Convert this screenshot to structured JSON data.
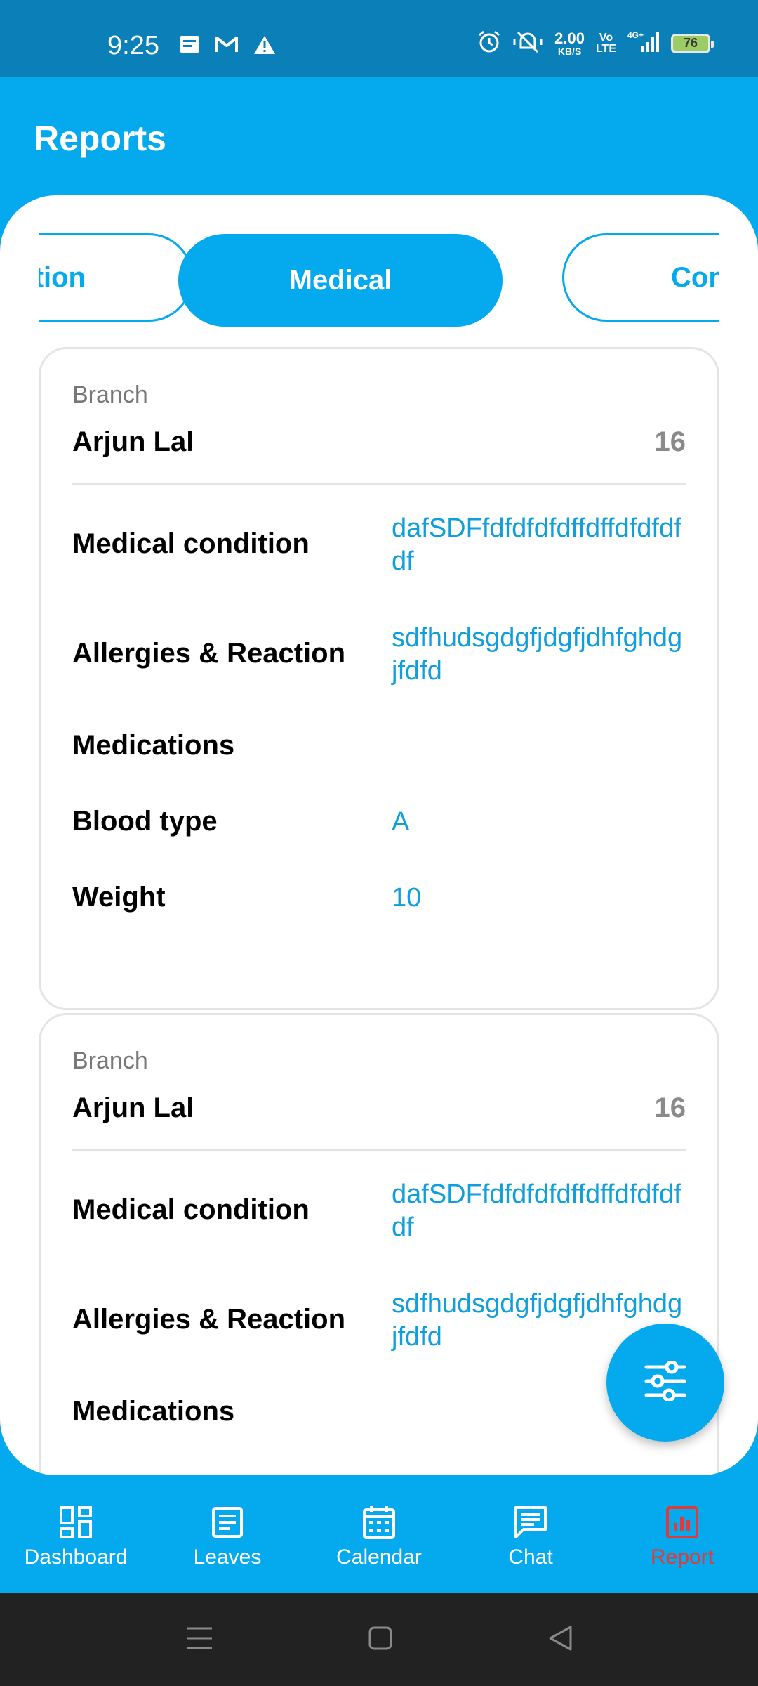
{
  "status_bar": {
    "time": "9:25",
    "net_speed_value": "2.00",
    "net_speed_unit": "KB/S",
    "volte_top": "Vo",
    "volte_bottom": "LTE",
    "network": "4G+",
    "battery": "76",
    "icons": [
      "message-icon",
      "gmail-icon",
      "warning-icon",
      "alarm-icon",
      "silent-icon",
      "signal-icon",
      "battery-icon"
    ]
  },
  "header": {
    "title": "Reports"
  },
  "tabs": [
    {
      "label": "tion",
      "active": false
    },
    {
      "label": "Medical",
      "active": true
    },
    {
      "label": "Con",
      "active": false
    }
  ],
  "cards": [
    {
      "label": "Branch",
      "name": "Arjun Lal",
      "number": "16",
      "rows": [
        {
          "label": "Medical condition",
          "value": "dafSDFfdfdfdfdffdffdfdfdfdf"
        },
        {
          "label": "Allergies & Reaction",
          "value": "sdfhudsgdgfjdgfjdhfghdgjfdfd"
        },
        {
          "label": "Medications",
          "value": ""
        },
        {
          "label": "Blood type",
          "value": "A"
        },
        {
          "label": "Weight",
          "value": "10"
        }
      ]
    },
    {
      "label": "Branch",
      "name": "Arjun Lal",
      "number": "16",
      "rows": [
        {
          "label": "Medical condition",
          "value": "dafSDFfdfdfdfdffdffdfdfdfdf"
        },
        {
          "label": "Allergies & Reaction",
          "value": "sdfhudsgdgfjdgfjdhfghdgjfdfd"
        },
        {
          "label": "Medications",
          "value": ""
        }
      ]
    }
  ],
  "fab": {
    "icon": "filter-sliders-icon"
  },
  "bottom_nav": [
    {
      "label": "Dashboard",
      "icon": "dashboard-icon",
      "active": false
    },
    {
      "label": "Leaves",
      "icon": "leaves-icon",
      "active": false
    },
    {
      "label": "Calendar",
      "icon": "calendar-icon",
      "active": false
    },
    {
      "label": "Chat",
      "icon": "chat-icon",
      "active": false
    },
    {
      "label": "Report",
      "icon": "report-icon",
      "active": true
    }
  ],
  "colors": {
    "primary": "#04A9EE",
    "status_bar": "#0A7FB8",
    "value_text": "#109FDC",
    "active_nav": "#E53935"
  }
}
